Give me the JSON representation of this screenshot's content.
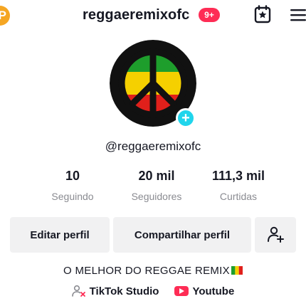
{
  "header": {
    "promo_badge": "P",
    "username": "reggaeremixofc",
    "notification_count": "9+",
    "icons": [
      "calendar-star-icon",
      "menu-icon"
    ]
  },
  "profile": {
    "handle": "@reggaeremixofc",
    "avatar_icon": "peace-sign-icon"
  },
  "stats": [
    {
      "value": "10",
      "label": "Seguindo"
    },
    {
      "value": "20 mil",
      "label": "Seguidores"
    },
    {
      "value": "111,3 mil",
      "label": "Curtidas"
    }
  ],
  "actions": {
    "edit_label": "Editar perfil",
    "share_label": "Compartilhar perfil",
    "add_friend_icon": "add-user-icon"
  },
  "bio": {
    "text": "O MELHOR DO REGGAE REMIX",
    "flag_icon": "reggae-flag-icon"
  },
  "links": [
    {
      "label": "TikTok Studio",
      "icon": "tiktok-studio-icon"
    },
    {
      "label": "Youtube",
      "icon": "youtube-icon"
    }
  ],
  "colors": {
    "accent": "#fe2c55",
    "add_badge": "#20d5ec",
    "secondary_text": "#8a8b91",
    "button_bg": "#f1f1f2"
  }
}
